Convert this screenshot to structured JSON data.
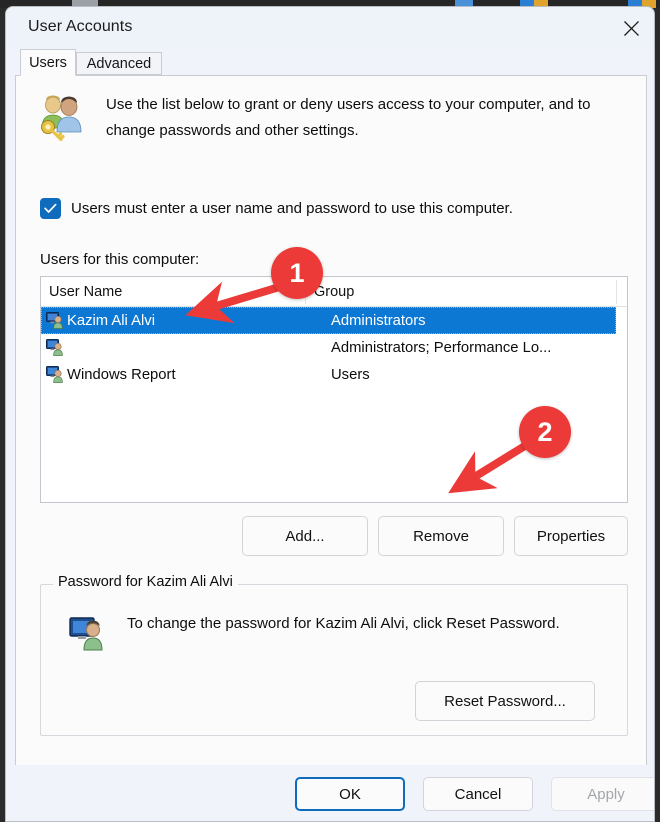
{
  "window": {
    "title": "User Accounts",
    "close_icon": "close-icon"
  },
  "tabs": [
    {
      "label": "Users",
      "active": true
    },
    {
      "label": "Advanced",
      "active": false
    }
  ],
  "intro": {
    "icon": "users-key-icon",
    "text": "Use the list below to grant or deny users access to your computer, and to change passwords and other settings."
  },
  "checkbox": {
    "label": "Users must enter a user name and password to use this computer.",
    "checked": true
  },
  "list": {
    "label": "Users for this computer:",
    "columns": [
      "User Name",
      "Group"
    ],
    "rows": [
      {
        "icon": "user-account-icon",
        "name": "Kazim Ali Alvi",
        "group": "Administrators",
        "selected": true
      },
      {
        "icon": "user-account-icon",
        "name": "",
        "group": "Administrators; Performance Lo...",
        "selected": false
      },
      {
        "icon": "user-account-icon",
        "name": "Windows Report",
        "group": "Users",
        "selected": false
      }
    ]
  },
  "list_buttons": {
    "add": "Add...",
    "remove": "Remove",
    "properties": "Properties"
  },
  "password_group": {
    "title": "Password for Kazim Ali Alvi",
    "icon": "user-monitor-icon",
    "text": "To change the password for Kazim Ali Alvi, click Reset Password.",
    "reset_button": "Reset Password..."
  },
  "footer": {
    "ok": "OK",
    "cancel": "Cancel",
    "apply": "Apply",
    "apply_disabled": true
  },
  "annotations": [
    {
      "badge": "1",
      "color": "#ec3a38"
    },
    {
      "badge": "2",
      "color": "#ec3a38"
    }
  ],
  "colors": {
    "accent": "#0f6cbd",
    "selection": "#0c78d4",
    "annotation": "#ec3a38",
    "titlebar": "#eef2f9",
    "page": "#fbfbfb"
  }
}
